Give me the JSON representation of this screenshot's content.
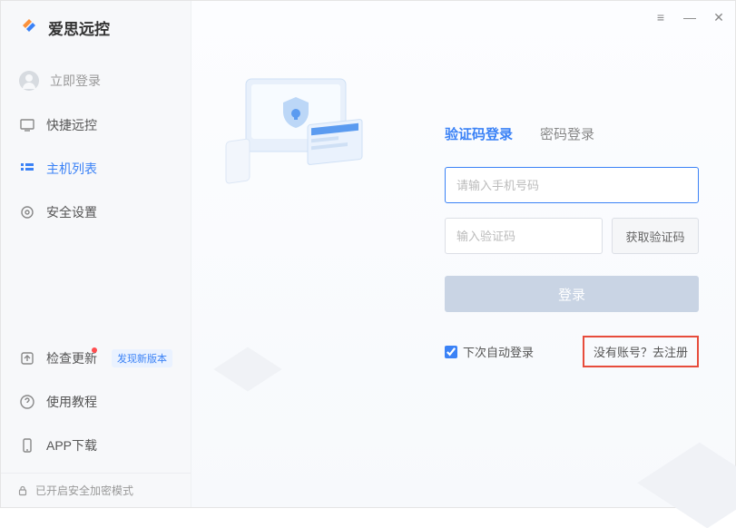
{
  "brand": {
    "name": "爱思远控"
  },
  "sidebar": {
    "login_cta": "立即登录",
    "items": [
      {
        "id": "quick",
        "label": "快捷远控"
      },
      {
        "id": "hosts",
        "label": "主机列表"
      },
      {
        "id": "security",
        "label": "安全设置"
      }
    ],
    "bottom_items": [
      {
        "id": "update",
        "label": "检查更新",
        "badge": "发现新版本",
        "dot": true
      },
      {
        "id": "tutorial",
        "label": "使用教程"
      },
      {
        "id": "app",
        "label": "APP下载"
      }
    ],
    "footer": "已开启安全加密模式"
  },
  "login": {
    "tabs": {
      "sms": "验证码登录",
      "pwd": "密码登录"
    },
    "phone_placeholder": "请输入手机号码",
    "code_placeholder": "输入验证码",
    "get_code": "获取验证码",
    "submit": "登录",
    "auto_login": "下次自动登录",
    "register": "没有账号？去注册"
  },
  "colors": {
    "accent": "#3b82f6",
    "highlight_border": "#e74c3c"
  }
}
